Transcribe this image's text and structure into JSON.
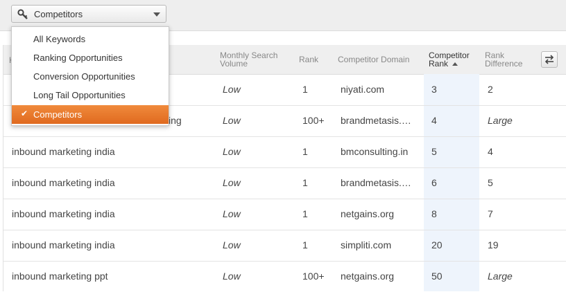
{
  "filter": {
    "selected_label": "Competitors",
    "icon": "key-icon",
    "options": [
      {
        "label": "All Keywords"
      },
      {
        "label": "Ranking Opportunities"
      },
      {
        "label": "Conversion Opportunities"
      },
      {
        "label": "Long Tail Opportunities"
      },
      {
        "label": "Competitors"
      }
    ]
  },
  "table": {
    "headers": {
      "keyword": "K",
      "volume_line1": "Monthly Search",
      "volume_line2": "Volume",
      "rank": "Rank",
      "domain": "Competitor Domain",
      "crank_line1": "Competitor",
      "crank_line2": "Rank",
      "diff_line1": "Rank",
      "diff_line2": "Difference"
    },
    "rows": [
      {
        "keyword": "",
        "volume": "Low",
        "rank": "1",
        "domain": "niyati.com",
        "crank": "3",
        "diff": "2"
      },
      {
        "keyword": "ing",
        "volume": "Low",
        "rank": "100+",
        "domain": "brandmetasis.…",
        "crank": "4",
        "diff": "Large"
      },
      {
        "keyword": "inbound marketing india",
        "volume": "Low",
        "rank": "1",
        "domain": "bmconsulting.in",
        "crank": "5",
        "diff": "4"
      },
      {
        "keyword": "inbound marketing india",
        "volume": "Low",
        "rank": "1",
        "domain": "brandmetasis.…",
        "crank": "6",
        "diff": "5"
      },
      {
        "keyword": "inbound marketing india",
        "volume": "Low",
        "rank": "1",
        "domain": "netgains.org",
        "crank": "8",
        "diff": "7"
      },
      {
        "keyword": "inbound marketing india",
        "volume": "Low",
        "rank": "1",
        "domain": "simpliti.com",
        "crank": "20",
        "diff": "19"
      },
      {
        "keyword": "inbound marketing ppt",
        "volume": "Low",
        "rank": "100+",
        "domain": "netgains.org",
        "crank": "50",
        "diff": "Large"
      }
    ]
  },
  "colors": {
    "accent": "#e8762c",
    "highlight_column": "#eef4fc"
  }
}
